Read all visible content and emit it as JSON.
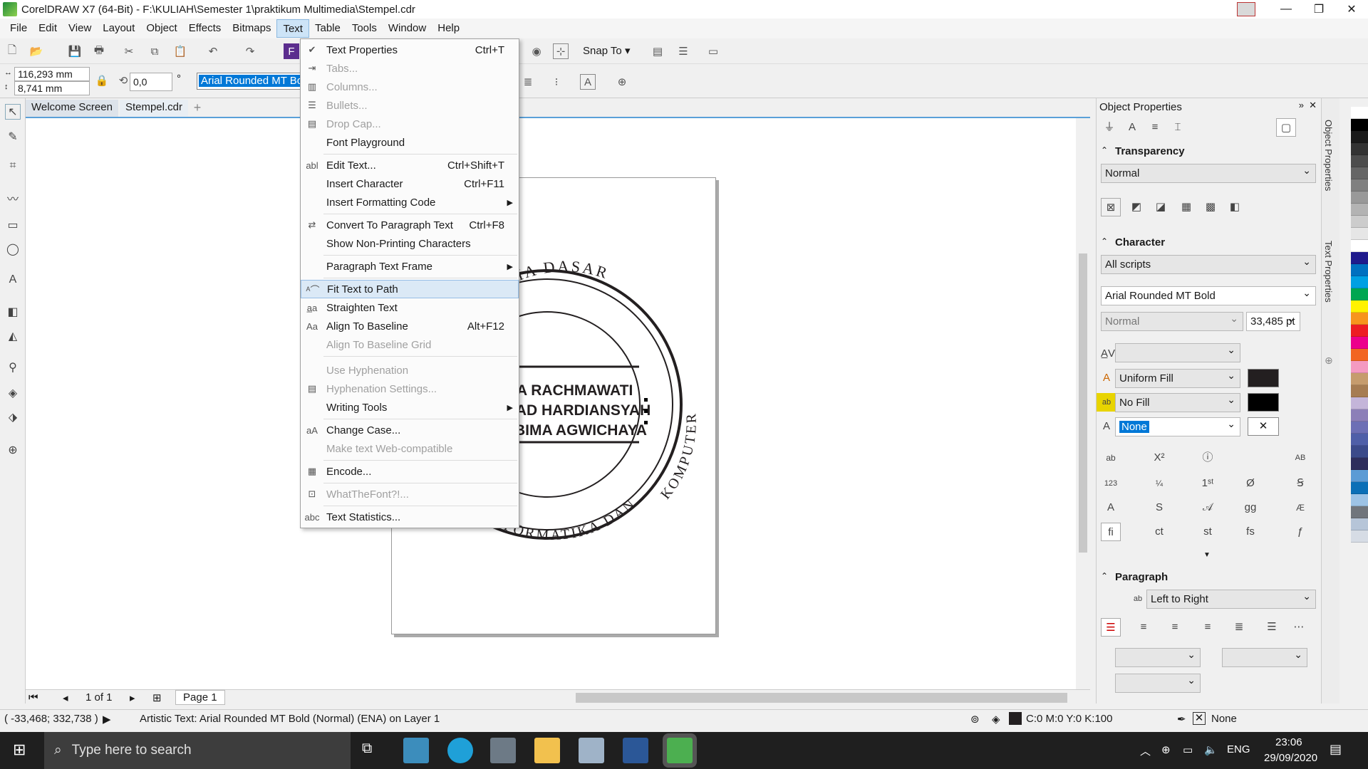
{
  "window": {
    "title": "CorelDRAW X7 (64-Bit) - F:\\KULIAH\\Semester 1\\praktikum Multimedia\\Stempel.cdr",
    "minimize": "—",
    "restore": "❐",
    "close": "✕"
  },
  "menubar": [
    "File",
    "Edit",
    "View",
    "Layout",
    "Object",
    "Effects",
    "Bitmaps",
    "Text",
    "Table",
    "Tools",
    "Window",
    "Help"
  ],
  "toolbar": {
    "snap_to": "Snap To",
    "width": "116,293 mm",
    "height": "8,741 mm",
    "angle": "0,0",
    "angle_unit": "°",
    "font": "Arial Rounded MT Bold"
  },
  "tabs": [
    "Welcome Screen",
    "Stempel.cdr"
  ],
  "text_menu": [
    {
      "label": "Text Properties",
      "shortcut": "Ctrl+T",
      "checked": true
    },
    {
      "label": "Tabs...",
      "disabled": true
    },
    {
      "label": "Columns...",
      "disabled": true
    },
    {
      "label": "Bullets...",
      "disabled": true
    },
    {
      "label": "Drop Cap...",
      "disabled": true
    },
    {
      "label": "Font Playground"
    },
    {
      "label": "Edit Text...",
      "shortcut": "Ctrl+Shift+T"
    },
    {
      "label": "Insert Character",
      "shortcut": "Ctrl+F11"
    },
    {
      "label": "Insert Formatting Code",
      "submenu": true
    },
    {
      "label": "Convert To Paragraph Text",
      "shortcut": "Ctrl+F8"
    },
    {
      "label": "Show Non-Printing Characters"
    },
    {
      "label": "Paragraph Text Frame",
      "submenu": true
    },
    {
      "label": "Fit Text to Path",
      "highlighted": true
    },
    {
      "label": "Straighten Text"
    },
    {
      "label": "Align To Baseline",
      "shortcut": "Alt+F12"
    },
    {
      "label": "Align To Baseline Grid",
      "disabled": true
    },
    {
      "label": "Use Hyphenation",
      "disabled": true
    },
    {
      "label": "Hyphenation Settings...",
      "disabled": true
    },
    {
      "label": "Writing Tools",
      "submenu": true
    },
    {
      "label": "Change Case..."
    },
    {
      "label": "Make text Web-compatible",
      "disabled": true
    },
    {
      "label": "Encode..."
    },
    {
      "label": "WhatTheFont?!...",
      "disabled": true
    },
    {
      "label": "Text Statistics..."
    }
  ],
  "stamp": {
    "top_arc": "MEDIA DASAR",
    "right_arc": "KOMPUTER",
    "bottom_arc": "INFORMATIKA DAN",
    "line1": "A RACHMAWATI",
    "line2": "IAD HARDIANSYAH",
    "line3": "BIMA AGWICHAYA"
  },
  "object_properties": {
    "title": "Object Properties",
    "transparency_title": "Transparency",
    "transparency_mode": "Normal",
    "character_title": "Character",
    "scripts": "All scripts",
    "font": "Arial Rounded MT Bold",
    "font_style": "Normal",
    "font_size": "33,485 pt",
    "fill": "Uniform Fill",
    "background_fill": "No Fill",
    "outline": "None",
    "paragraph_title": "Paragraph",
    "direction": "Left to Right",
    "fill_color": "#231f20",
    "bg_color": "#000000"
  },
  "side_tabs": [
    "Object Properties",
    "Text Properties"
  ],
  "page_nav": {
    "count": "1 of 1",
    "page_tab": "Page 1"
  },
  "status": {
    "coords": "( -33,468; 332,738 )",
    "object_info": "Artistic Text: Arial Rounded MT Bold (Normal) (ENA) on Layer 1",
    "fill_info": "C:0 M:0 Y:0 K:100",
    "outline_info": "None"
  },
  "taskbar": {
    "search_placeholder": "Type here to search",
    "lang": "ENG",
    "time": "23:06",
    "date": "29/09/2020"
  },
  "palette_colors": [
    "#ffffff",
    "#000000",
    "#1a1a1a",
    "#333333",
    "#4d4d4d",
    "#666666",
    "#808080",
    "#999999",
    "#b3b3b3",
    "#cccccc",
    "#e6e6e6",
    "#ffffff",
    "#1f1a8c",
    "#0070c0",
    "#00a0e3",
    "#00a651",
    "#fff200",
    "#f7941d",
    "#ed1c24",
    "#ec008c",
    "#f26522",
    "#f49ac1",
    "#c69c6d",
    "#a67c52",
    "#c4b5d9",
    "#8c7fb8",
    "#6d6fb5",
    "#4f5fa8",
    "#3b4a8a",
    "#2e2e5c",
    "#5b9bd5",
    "#0b6fb7",
    "#9dc3e6",
    "#70757c",
    "#b6c5d8",
    "#d6dce5"
  ]
}
